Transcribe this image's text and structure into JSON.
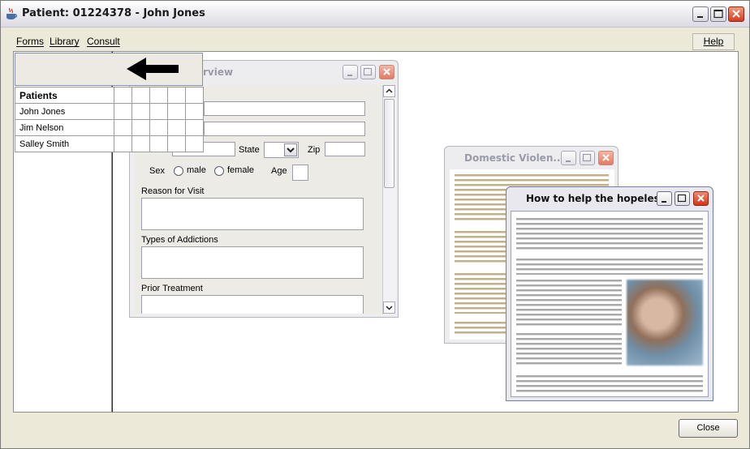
{
  "window": {
    "title": "Patient: 01224378 - John Jones"
  },
  "menubar": {
    "forms": "Forms",
    "library": "Library",
    "consult": "Consult",
    "help": "Help"
  },
  "patients": {
    "header": "Patients",
    "rows": [
      "John Jones",
      "Jim Nelson",
      "Salley Smith"
    ]
  },
  "overview_form": {
    "title": "rview",
    "state_label": "State",
    "zip_label": "Zip",
    "sex_label": "Sex",
    "male_label": "male",
    "female_label": "female",
    "age_label": "Age",
    "reason_label": "Reason for Visit",
    "addictions_label": "Types of Addictions",
    "prior_label": "Prior Treatment"
  },
  "domestic_window": {
    "title": "Domestic Violen..."
  },
  "hopeless_window": {
    "title": "How to help the hopeless"
  },
  "footer": {
    "close_label": "Close"
  },
  "icons": {
    "app": "java-cup-icon",
    "back": "arrow-left-icon"
  }
}
